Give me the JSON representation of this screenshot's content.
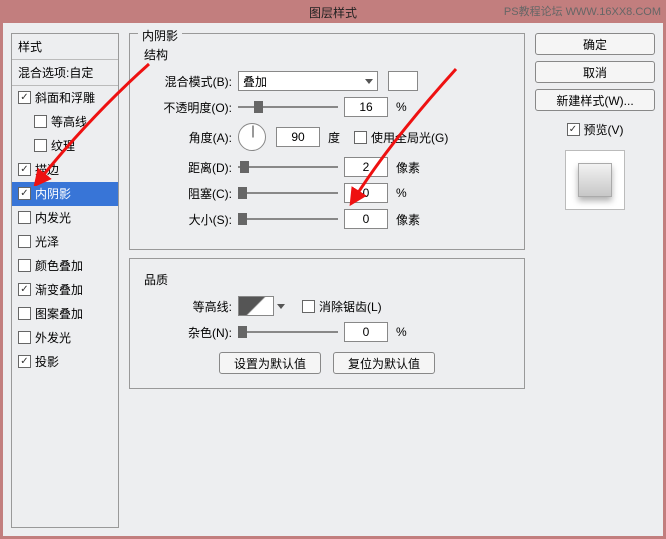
{
  "watermark": "PS教程论坛  WWW.16XX8.COM",
  "title": "图层样式",
  "styles_panel": {
    "header": "样式",
    "blend_options": "混合选项:自定",
    "items": [
      {
        "label": "斜面和浮雕",
        "checked": true,
        "sub": false
      },
      {
        "label": "等高线",
        "checked": false,
        "sub": true
      },
      {
        "label": "纹理",
        "checked": false,
        "sub": true
      },
      {
        "label": "描边",
        "checked": true,
        "sub": false
      },
      {
        "label": "内阴影",
        "checked": true,
        "sub": false,
        "active": true
      },
      {
        "label": "内发光",
        "checked": false,
        "sub": false
      },
      {
        "label": "光泽",
        "checked": false,
        "sub": false
      },
      {
        "label": "颜色叠加",
        "checked": false,
        "sub": false
      },
      {
        "label": "渐变叠加",
        "checked": true,
        "sub": false
      },
      {
        "label": "图案叠加",
        "checked": false,
        "sub": false
      },
      {
        "label": "外发光",
        "checked": false,
        "sub": false
      },
      {
        "label": "投影",
        "checked": true,
        "sub": false
      }
    ]
  },
  "main": {
    "group_title": "内阴影",
    "structure_title": "结构",
    "blend_mode_label": "混合模式(B):",
    "blend_mode_value": "叠加",
    "opacity_label": "不透明度(O):",
    "opacity_value": "16",
    "opacity_unit": "%",
    "angle_label": "角度(A):",
    "angle_value": "90",
    "angle_unit": "度",
    "global_light": "使用全局光(G)",
    "distance_label": "距离(D):",
    "distance_value": "2",
    "distance_unit": "像素",
    "choke_label": "阻塞(C):",
    "choke_value": "0",
    "choke_unit": "%",
    "size_label": "大小(S):",
    "size_value": "0",
    "size_unit": "像素",
    "quality_title": "品质",
    "contour_label": "等高线:",
    "antialias": "消除锯齿(L)",
    "noise_label": "杂色(N):",
    "noise_value": "0",
    "noise_unit": "%",
    "make_default": "设置为默认值",
    "reset_default": "复位为默认值"
  },
  "sidebar": {
    "ok": "确定",
    "cancel": "取消",
    "new_style": "新建样式(W)...",
    "preview": "预览(V)"
  }
}
